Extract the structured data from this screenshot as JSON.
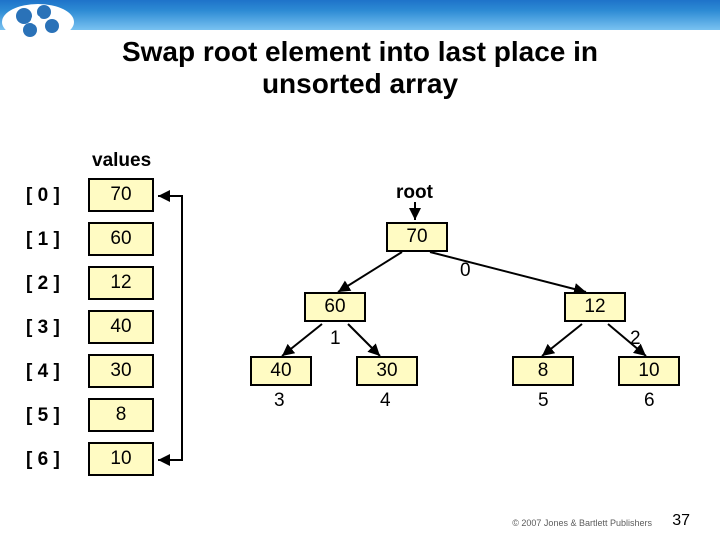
{
  "header": {
    "title": "Swap root element into last place in\nunsorted array"
  },
  "array": {
    "label": "values",
    "rows": [
      {
        "index": "[ 0 ]",
        "value": "70"
      },
      {
        "index": "[ 1 ]",
        "value": "60"
      },
      {
        "index": "[ 2 ]",
        "value": "12"
      },
      {
        "index": "[ 3 ]",
        "value": "40"
      },
      {
        "index": "[ 4 ]",
        "value": "30"
      },
      {
        "index": "[ 5 ]",
        "value": "8"
      },
      {
        "index": "[ 6 ]",
        "value": "10"
      }
    ]
  },
  "tree": {
    "root_label": "root",
    "nodes": {
      "n0": {
        "value": "70",
        "index": "0"
      },
      "n1": {
        "value": "60",
        "index": "1"
      },
      "n2": {
        "value": "12",
        "index": "2"
      },
      "n3": {
        "value": "40",
        "index": "3"
      },
      "n4": {
        "value": "30",
        "index": "4"
      },
      "n5": {
        "value": "8",
        "index": "5"
      },
      "n6": {
        "value": "10",
        "index": "6"
      }
    }
  },
  "footer": {
    "page": "37",
    "publisher": "© 2007 Jones & Bartlett Publishers"
  }
}
